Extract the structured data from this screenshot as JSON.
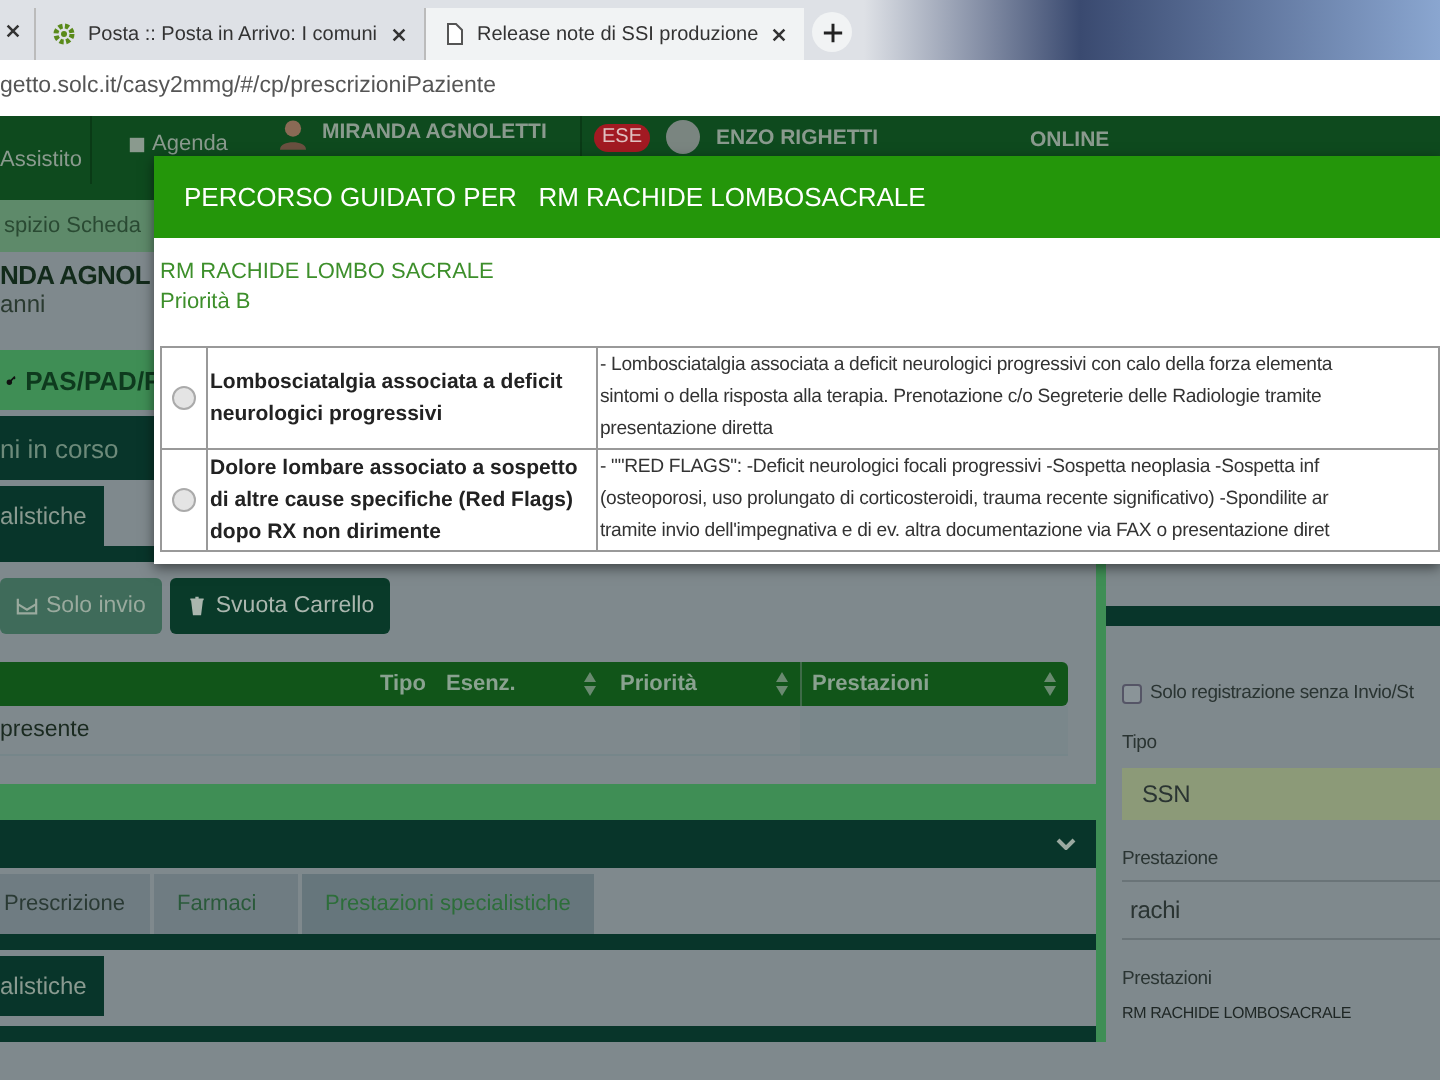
{
  "browser": {
    "tabs": [
      {
        "title": "Posta :: Posta in Arrivo: I comuni"
      },
      {
        "title": "Release note di SSI produzione"
      }
    ],
    "address": "getto.solc.it/casy2mmg/#/cp/prescrizioniPaziente"
  },
  "nav": {
    "assistito": "Assistito",
    "agenda": "Agenda",
    "patient": "MIRANDA AGNOLETTI",
    "badge": "ESE",
    "doctor": "ENZO RIGHETTI",
    "status": "ONLINE"
  },
  "breadcrumb": "spizio Scheda",
  "patient_name": "NDA AGNOL",
  "patient_age": "anni",
  "pas_button": "PAS/PAD/F",
  "strip": "ni in corso",
  "side_tab": "alistiche",
  "actions": [
    {
      "label": "Solo invio",
      "kind": "send"
    },
    {
      "label": "Svuota Carrello",
      "kind": "trash"
    }
  ],
  "table": {
    "columns": [
      {
        "label": "Tipo",
        "sortable": false
      },
      {
        "label": "Esenz.",
        "sortable": true
      },
      {
        "label": "Priorità",
        "sortable": true
      },
      {
        "label": "Prestazioni",
        "sortable": true
      }
    ],
    "empty_text": "presente"
  },
  "tabs": [
    {
      "label": "Prescrizione",
      "selected": false
    },
    {
      "label": "Farmaci",
      "selected": false
    },
    {
      "label": "Prestazioni specialistiche",
      "selected": true
    }
  ],
  "bottom_tab": "alistiche",
  "right_panel": {
    "checkbox": {
      "label": "Solo registrazione senza Invio/St",
      "checked": false
    },
    "tipo_label": "Tipo",
    "tipo_value": "SSN",
    "prestazione_label": "Prestazione",
    "prestazione_value": "rachi",
    "prestazioni_label": "Prestazioni",
    "prestazioni_value": "RM RACHIDE LOMBOSACRALE"
  },
  "modal": {
    "title": "PERCORSO GUIDATO PER   RM RACHIDE LOMBOSACRALE",
    "exam": "RM RACHIDE LOMBO SACRALE",
    "priority": "Priorità B",
    "rows": [
      {
        "selected": false,
        "condition": "Lombosciatalgia associata a deficit neurologici progressivi",
        "description": [
          "- Lombosciatalgia associata a deficit neurologici progressivi con calo della forza elementa",
          "sintomi o della risposta alla terapia. Prenotazione c/o Segreterie delle Radiologie tramite",
          "presentazione diretta"
        ]
      },
      {
        "selected": false,
        "condition": "Dolore lombare associato a sospetto di altre cause specifiche (Red Flags) dopo RX non dirimente",
        "description": [
          "- \"\"RED FLAGS\":  -Deficit neurologici focali progressivi -Sospetta neoplasia  -Sospetta inf",
          "(osteoporosi, uso prolungato di corticosteroidi, trauma recente significativo) -Spondilite ar",
          "tramite invio dell'impegnativa e di ev. altra documentazione via FAX o presentazione diret"
        ]
      }
    ]
  }
}
